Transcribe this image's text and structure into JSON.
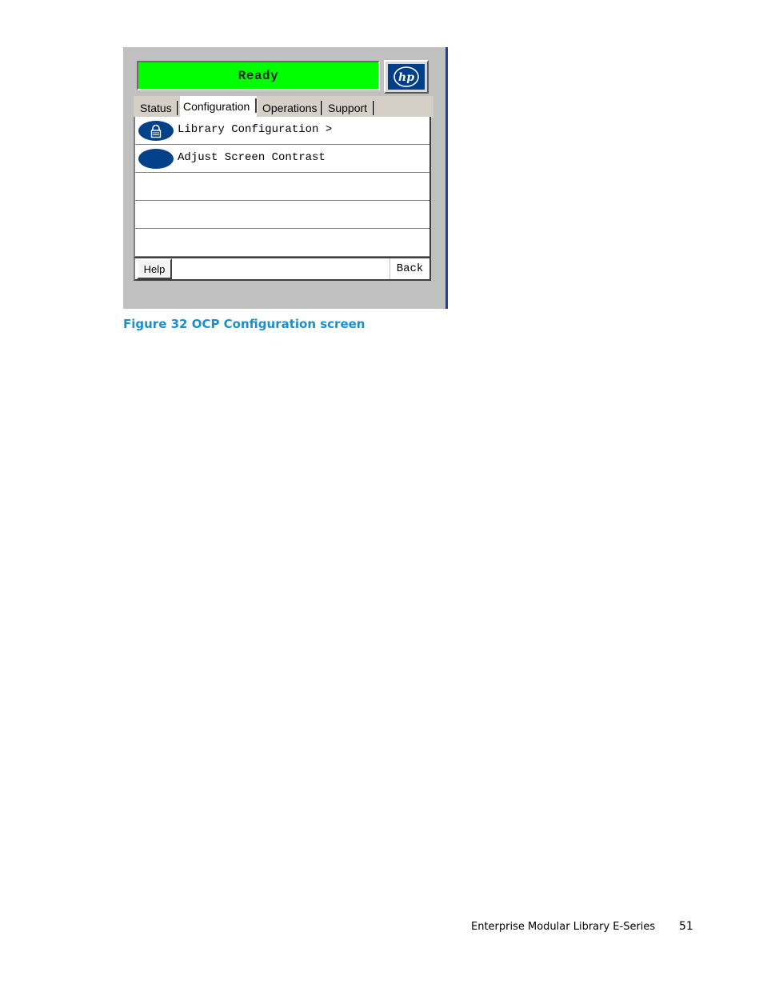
{
  "ocp": {
    "status_text": "Ready",
    "status_color": "#00ff00",
    "brand_color": "#003e8a",
    "logo_icon": "hp-logo-icon",
    "tabs": [
      {
        "label": "Status"
      },
      {
        "label": "Configuration",
        "active": true
      },
      {
        "label": "Operations"
      },
      {
        "label": "Support"
      }
    ],
    "menu_items": [
      {
        "label": "Library Configuration >",
        "icon": "lock-icon"
      },
      {
        "label": "Adjust Screen Contrast",
        "icon": "oval-icon"
      },
      {
        "label": ""
      },
      {
        "label": ""
      },
      {
        "label": ""
      }
    ],
    "help_label": "Help",
    "back_label": "Back"
  },
  "caption": "Figure 32 OCP Configuration screen",
  "caption_color": "#1a8fd0",
  "footer": {
    "title": "Enterprise Modular Library E-Series",
    "page_number": "51"
  }
}
